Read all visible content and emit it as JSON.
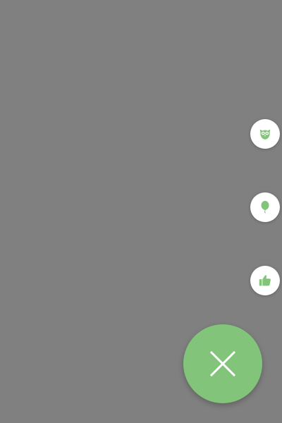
{
  "colors": {
    "overlay_background": "#808080",
    "accent_green": "#81c47a",
    "mini_fab_background": "#ffffff",
    "close_icon": "#ffffff"
  },
  "actions": [
    {
      "icon": "owl-icon"
    },
    {
      "icon": "balloon-icon"
    },
    {
      "icon": "thumbs-up-icon"
    }
  ],
  "main_fab": {
    "icon": "close-icon"
  }
}
